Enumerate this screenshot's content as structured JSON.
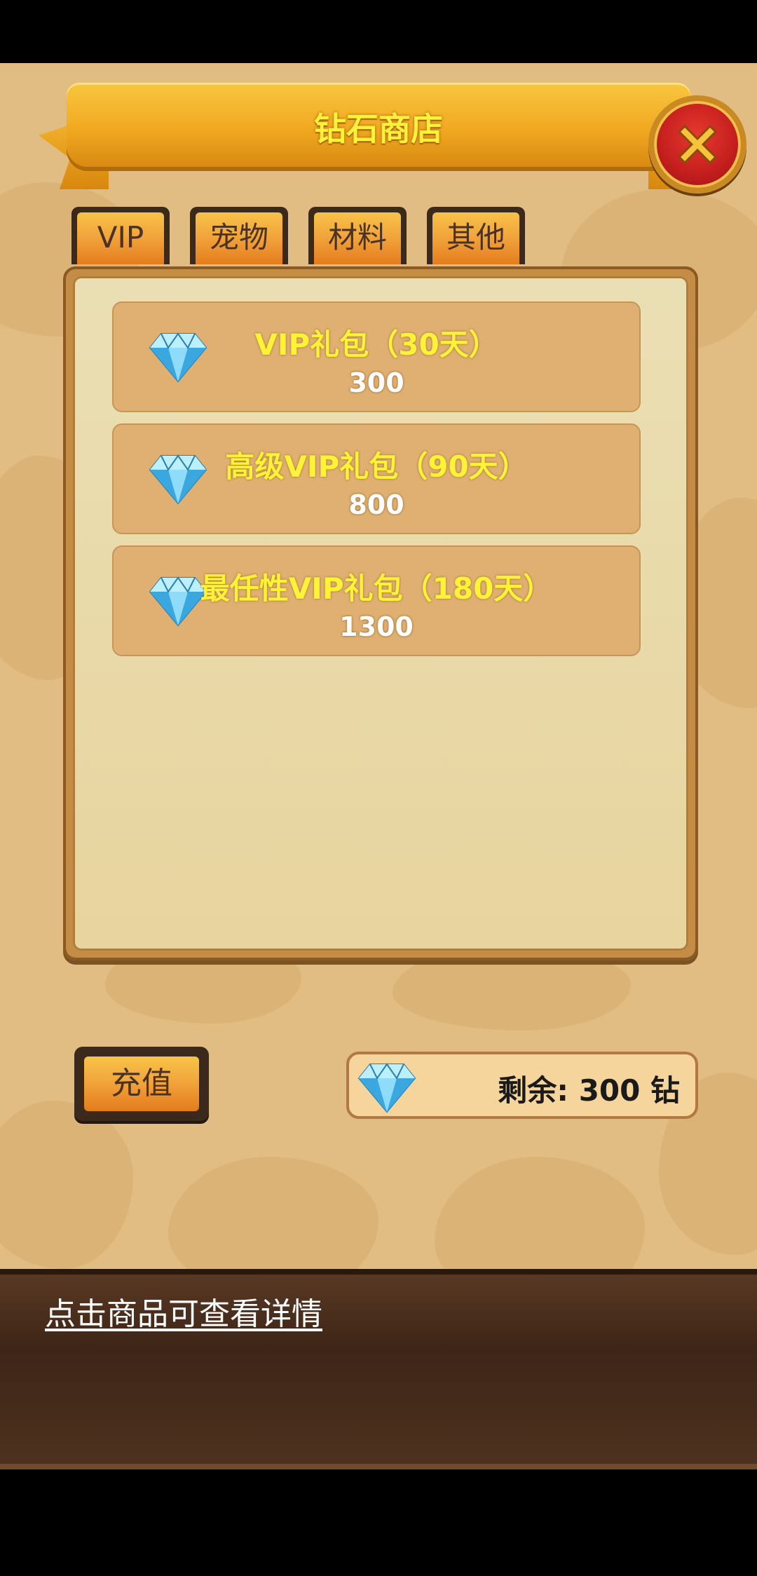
{
  "header": {
    "title": "钻石商店"
  },
  "tabs": [
    {
      "label": "VIP"
    },
    {
      "label": "宠物"
    },
    {
      "label": "材料"
    },
    {
      "label": "其他"
    }
  ],
  "items": [
    {
      "name": "VIP礼包（30天）",
      "price": "300"
    },
    {
      "name": "高级VIP礼包（90天）",
      "price": "800"
    },
    {
      "name": "最任性VIP礼包（180天）",
      "price": "1300"
    }
  ],
  "footer": {
    "recharge_label": "充值",
    "balance_text": "剩余: 300 钻"
  },
  "hint": "点击商品可查看详情",
  "colors": {
    "title_yellow": "#fff23a",
    "close_red": "#c21d1d",
    "gem_blue": "#5cc8f2"
  },
  "icons": [
    "close-icon",
    "diamond-icon"
  ]
}
